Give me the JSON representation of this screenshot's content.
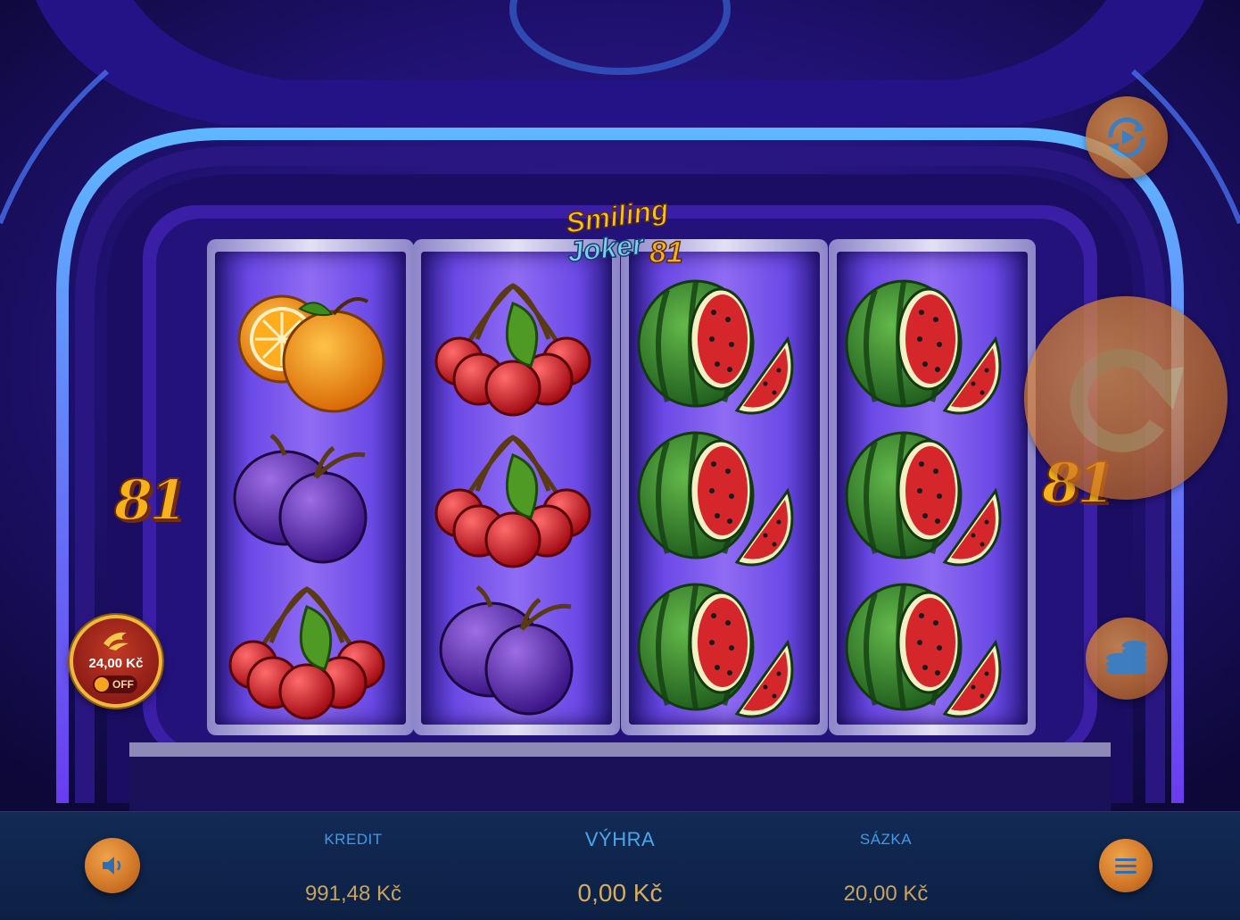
{
  "game": {
    "logo": {
      "line1": "Smiling",
      "line2": "Joker",
      "line3": "81"
    },
    "side_badge_left": "81",
    "side_badge_right": "81"
  },
  "reels": [
    [
      "orange",
      "plum",
      "cherries"
    ],
    [
      "cherries",
      "cherries",
      "plum"
    ],
    [
      "watermelon",
      "watermelon",
      "watermelon"
    ],
    [
      "watermelon",
      "watermelon",
      "watermelon"
    ]
  ],
  "bonus": {
    "amount": "24,00 Kč",
    "toggle_label": "OFF",
    "icon": "flame-icon"
  },
  "controls": {
    "autoplay_icon": "autoplay-icon",
    "spin_icon": "spin-arrow-icon",
    "bet_icon": "coins-icon",
    "sound_icon": "speaker-icon",
    "menu_icon": "menu-icon"
  },
  "bottom_bar": {
    "credit_label": "KREDIT",
    "credit_value": "991,48 Kč",
    "win_label": "VÝHRA",
    "win_value": "0,00 Kč",
    "bet_label": "SÁZKA",
    "bet_value": "20,00 Kč"
  },
  "colors": {
    "accent_orange": "#e08a33",
    "label_blue": "#3f9be6",
    "value_gold": "#c9a35a",
    "background": "#150d4a"
  }
}
